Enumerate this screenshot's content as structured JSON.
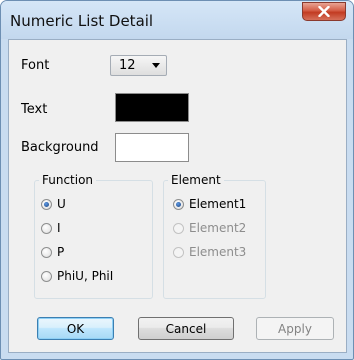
{
  "window": {
    "title": "Numeric List Detail"
  },
  "form": {
    "font_label": "Font",
    "font_size": "12",
    "text_label": "Text",
    "text_color": "#000000",
    "background_label": "Background",
    "background_color": "#ffffff"
  },
  "function_group": {
    "legend": "Function",
    "options": [
      {
        "label": "U",
        "checked": true,
        "enabled": true
      },
      {
        "label": "I",
        "checked": false,
        "enabled": true
      },
      {
        "label": "P",
        "checked": false,
        "enabled": true
      },
      {
        "label": "PhiU, PhiI",
        "checked": false,
        "enabled": true
      }
    ]
  },
  "element_group": {
    "legend": "Element",
    "options": [
      {
        "label": "Element1",
        "checked": true,
        "enabled": true
      },
      {
        "label": "Element2",
        "checked": false,
        "enabled": false
      },
      {
        "label": "Element3",
        "checked": false,
        "enabled": false
      }
    ]
  },
  "buttons": {
    "ok": "OK",
    "cancel": "Cancel",
    "apply": "Apply"
  }
}
